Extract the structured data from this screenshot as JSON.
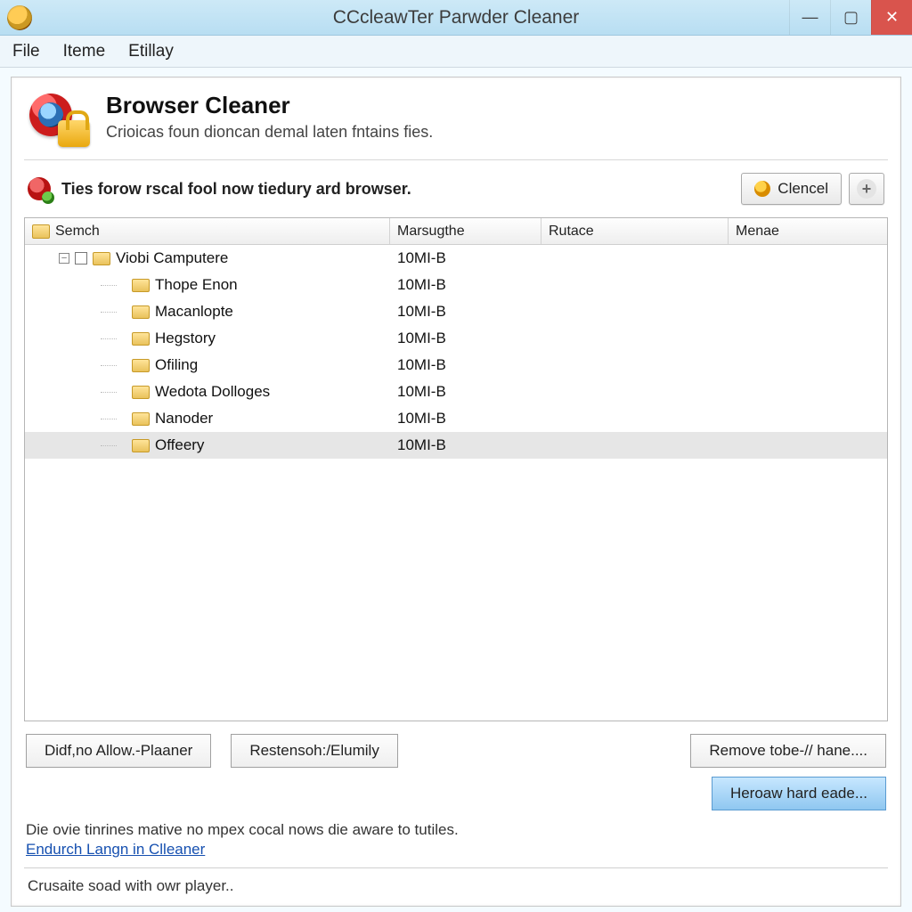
{
  "window": {
    "title": "CCcleawTer Parwder Cleaner"
  },
  "menu": {
    "items": [
      "File",
      "Iteme",
      "Etillay"
    ]
  },
  "header": {
    "title": "Browser Cleaner",
    "subtitle": "Crioicas foun dioncan demal laten fntains fies."
  },
  "info": {
    "text": "Ties forow rscal fool now tiedury ard browser."
  },
  "toolbar": {
    "clencel_label": "Clencel"
  },
  "tree": {
    "columns": [
      "Semch",
      "Marsugthe",
      "Rutace",
      "Menae"
    ],
    "root": {
      "name": "Viobi Camputere",
      "size": "10MI-B"
    },
    "children": [
      {
        "name": "Thope Enon",
        "size": "10MI-B"
      },
      {
        "name": "Macanlopte",
        "size": "10MI-B"
      },
      {
        "name": "Hegstory",
        "size": "10MI-B"
      },
      {
        "name": "Ofiling",
        "size": "10MI-B"
      },
      {
        "name": "Wedota Dolloges",
        "size": "10MI-B"
      },
      {
        "name": "Nanoder",
        "size": "10MI-B"
      },
      {
        "name": "Offeery",
        "size": "10MI-B",
        "selected": true
      }
    ]
  },
  "footer": {
    "btn1": "Didf,no Allow.-Plaaner",
    "btn2": "Restensoh:/Elumily",
    "btn3": "Remove tobe-// hane....",
    "btn4": "Heroaw hard eade...",
    "note": "Die ovie tinrines mative no mpex cocal nows die aware to tutiles.",
    "link": "Endurch Langn in Clleaner",
    "status": "Crusaite soad with owr player.."
  }
}
